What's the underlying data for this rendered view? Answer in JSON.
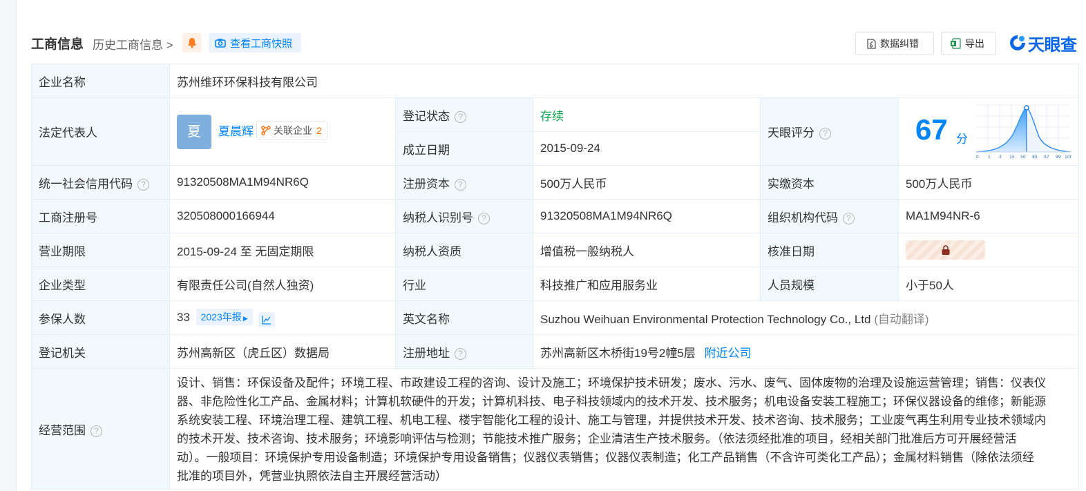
{
  "header": {
    "title": "工商信息",
    "history": "历史工商信息",
    "snapshot": "查看工商快照",
    "correct": "数据纠错",
    "export": "导出",
    "logo": "天眼查"
  },
  "company_name": {
    "label": "企业名称",
    "value": "苏州维环环保科技有限公司"
  },
  "legal_rep": {
    "label": "法定代表人",
    "avatar": "夏",
    "name": "夏晨辉",
    "related_label": "关联企业",
    "related_count": "2"
  },
  "reg_status": {
    "label": "登记状态",
    "value": "存续"
  },
  "established": {
    "label": "成立日期",
    "value": "2015-09-24"
  },
  "score": {
    "label": "天眼评分",
    "value": "67",
    "unit": "分",
    "axis_ticks": [
      "0",
      "1",
      "3",
      "15",
      "50",
      "85",
      "97",
      "99",
      "100"
    ]
  },
  "credit_code": {
    "label": "统一社会信用代码",
    "value": "91320508MA1M94NR6Q"
  },
  "reg_capital": {
    "label": "注册资本",
    "value": "500万人民币"
  },
  "paid_capital": {
    "label": "实缴资本",
    "value": "500万人民币"
  },
  "reg_no": {
    "label": "工商注册号",
    "value": "320508000166944"
  },
  "taxpayer_id": {
    "label": "纳税人识别号",
    "value": "91320508MA1M94NR6Q"
  },
  "org_code": {
    "label": "组织机构代码",
    "value": "MA1M94NR-6"
  },
  "term": {
    "label": "营业期限",
    "value": "2015-09-24 至 无固定期限"
  },
  "taxpayer_qual": {
    "label": "纳税人资质",
    "value": "增值税一般纳税人"
  },
  "approval_date": {
    "label": "核准日期"
  },
  "company_type": {
    "label": "企业类型",
    "value": "有限责任公司(自然人独资)"
  },
  "industry": {
    "label": "行业",
    "value": "科技推广和应用服务业"
  },
  "staff_size": {
    "label": "人员规模",
    "value": "小于50人"
  },
  "insured": {
    "label": "参保人数",
    "value": "33",
    "report": "2023年报"
  },
  "english_name": {
    "label": "英文名称",
    "value": "Suzhou Weihuan Environmental Protection Technology Co., Ltd",
    "note": "(自动翻译)"
  },
  "authority": {
    "label": "登记机关",
    "value": "苏州高新区（虎丘区）数据局"
  },
  "address": {
    "label": "注册地址",
    "value": "苏州高新区木桥街19号2幢5层",
    "nearby": "附近公司"
  },
  "scope": {
    "label": "经营范围",
    "lines": [
      "设计、销售：环保设备及配件；环境工程、市政建设工程的咨询、设计及施工；环境保护技术研发；废水、污水、废气、固体废物的治理及设施运营管理；销售：仪表仪",
      "器、非危险性化工产品、金属材料；计算机软硬件的开发；计算机科技、电子科技领域内的技术开发、技术服务；机电设备安装工程施工；环保仪器设备的维修；新能源",
      "系统安装工程、环境治理工程、建筑工程、机电工程、楼宇智能化工程的设计、施工与管理，并提供技术开发、技术咨询、技术服务；工业废气再生利用专业技术领域内",
      "的技术开发、技术咨询、技术服务；环境影响评估与检测；节能技术推广服务；企业清洁生产技术服务。（依法须经批准的项目，经相关部门批准后方可开展经营活",
      "动）。一般项目：环境保护专用设备制造；环境保护专用设备销售；仪器仪表销售；仪器仪表制造；化工产品销售（不含许可类化工产品）；金属材料销售（除依法须经",
      "批准的项目外，凭营业执照依法自主开展经营活动）"
    ]
  },
  "colors": {
    "accent": "#0084ff",
    "status_green": "#10a64e",
    "label_bg": "#f2f9fc",
    "warn_orange": "#ff6a00"
  }
}
